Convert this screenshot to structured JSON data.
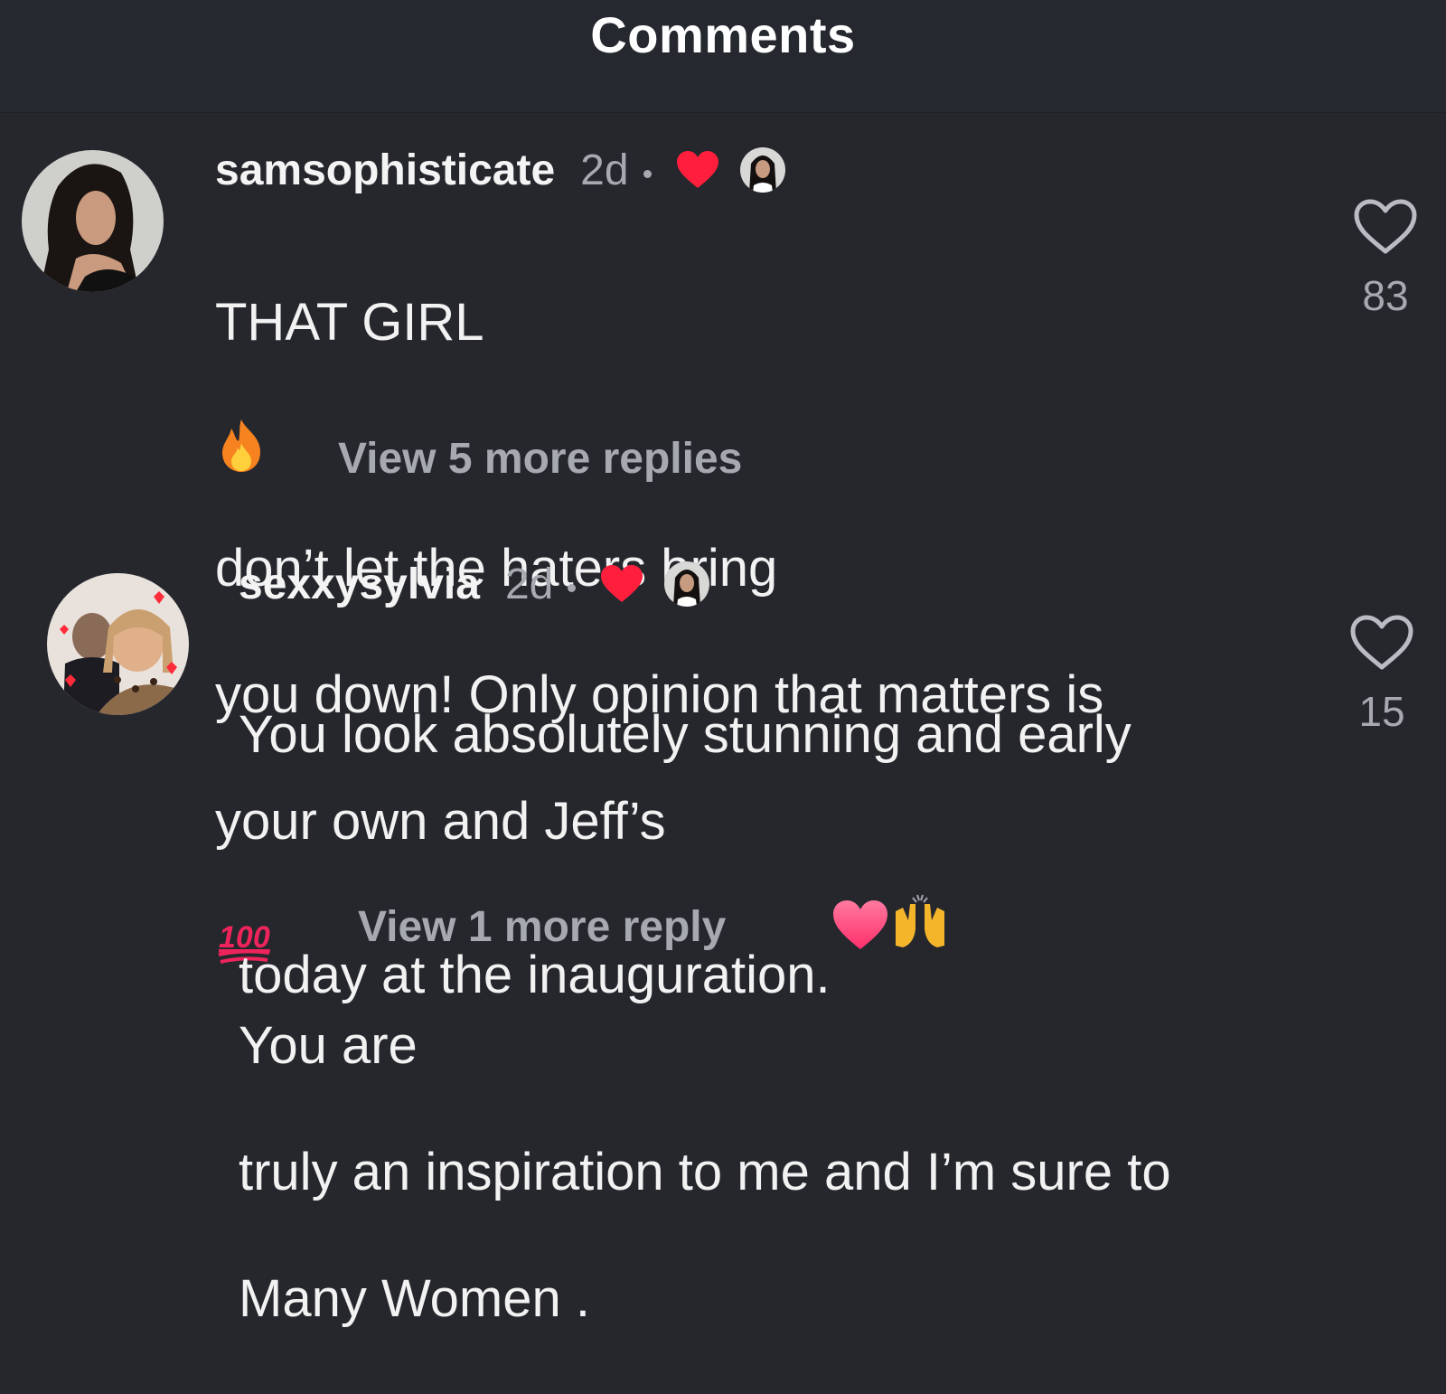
{
  "header": {
    "title": "Comments"
  },
  "comments": [
    {
      "username": "samsophisticate",
      "time": "2d",
      "line1_a": "THAT GIRL",
      "line1_b": "don’t let the haters bring",
      "line2": "you down! Only opinion that matters is",
      "line3": "your own and Jeff’s",
      "view_replies": "View 5 more replies",
      "likes": "83",
      "emojis": [
        "fire-emoji",
        "hundred-points-emoji"
      ],
      "icons": {
        "liked_by_author": "red-heart-icon",
        "like": "heart-outline-icon"
      }
    },
    {
      "username": "sexxysylvia",
      "time": "2d",
      "line1": "You look absolutely stunning and early",
      "line2_a": "today at the inauguration.",
      "line2_b": "You are",
      "line3": "truly an inspiration to me and I’m sure to",
      "line4": "Many Women .",
      "view_replies": "View 1 more reply",
      "likes": "15",
      "emojis": [
        "pink-heart-emoji",
        "raising-hands-emoji"
      ],
      "icons": {
        "liked_by_author": "red-heart-icon",
        "like": "heart-outline-icon"
      }
    }
  ],
  "colors": {
    "background": "#25272d",
    "muted_text": "#a6a9b0",
    "heart_red": "#ff1f3d"
  }
}
